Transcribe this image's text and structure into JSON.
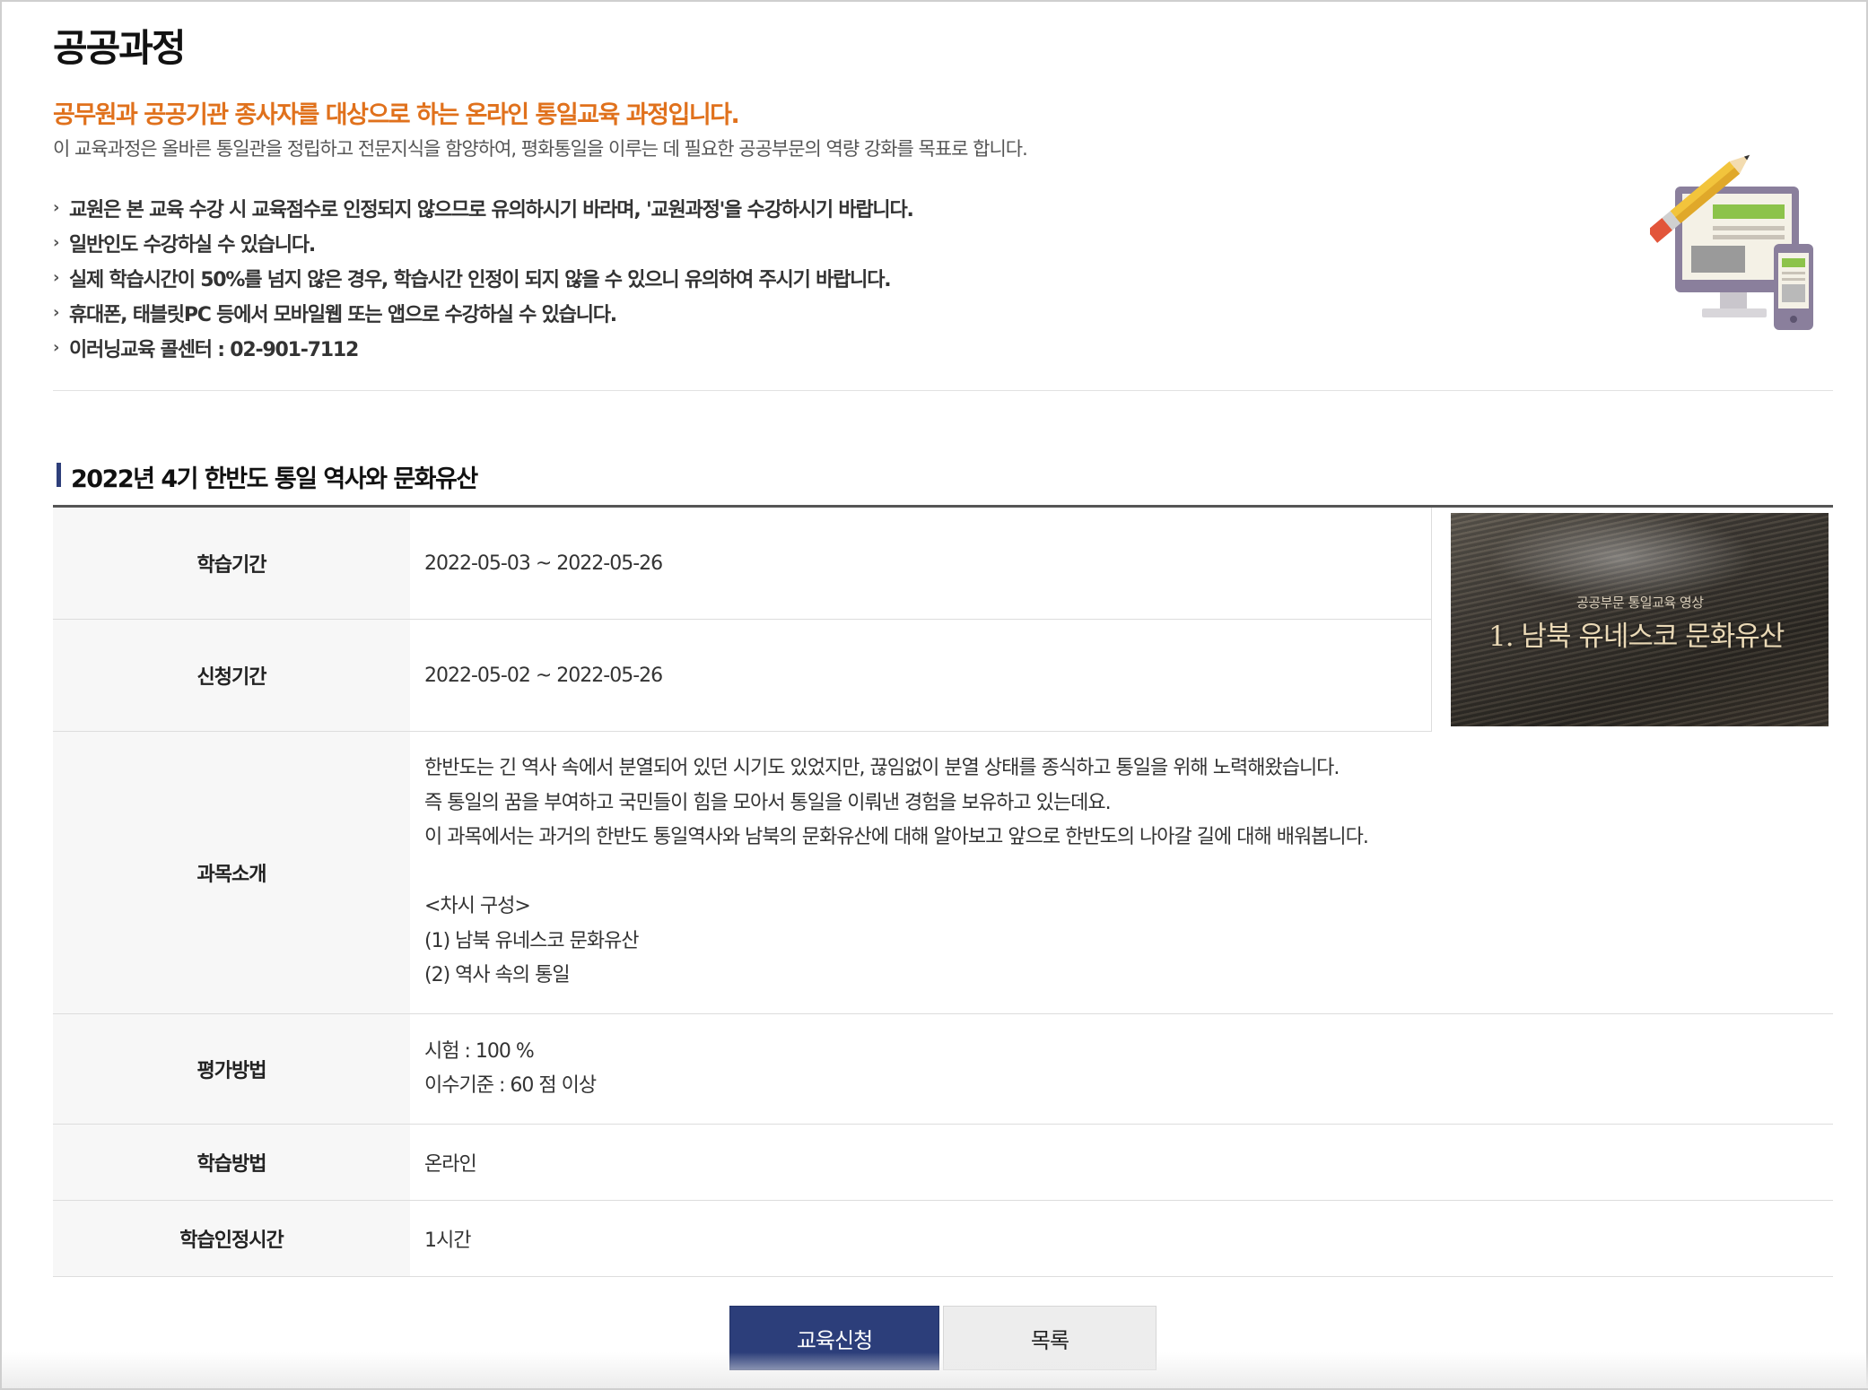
{
  "page": {
    "title": "공공과정"
  },
  "intro": {
    "headline": "공무원과 공공기관 종사자를 대상으로 하는 온라인 통일교육 과정입니다.",
    "description": "이 교육과정은 올바른 통일관을 정립하고 전문지식을 함양하여, 평화통일을 이루는 데 필요한 공공부문의 역량 강화를 목표로 합니다.",
    "notices": [
      "교원은 본 교육 수강 시 교육점수로 인정되지 않으므로 유의하시기 바라며, '교원과정'을 수강하시기 바랍니다.",
      "일반인도 수강하실 수 있습니다.",
      "실제 학습시간이 50%를 넘지 않은 경우, 학습시간 인정이 되지 않을 수 있으니 유의하여 주시기 바랍니다.",
      "휴대폰, 태블릿PC 등에서 모바일웹 또는 앱으로 수강하실 수 있습니다.",
      "이러닝교육 콜센터 : 02-901-7112"
    ],
    "notice_marker": "›",
    "illustration_icon": "pencil-monitor-mobile-icon"
  },
  "course": {
    "title": "2022년 4기 한반도 통일 역사와 문화유산",
    "thumbnail": {
      "subtitle": "공공부문 통일교육 영상",
      "caption": "1. 남북 유네스코 문화유산"
    },
    "rows": {
      "study_period": {
        "label": "학습기간",
        "value": "2022-05-03 ~ 2022-05-26"
      },
      "apply_period": {
        "label": "신청기간",
        "value": "2022-05-02 ~ 2022-05-26"
      },
      "intro": {
        "label": "과목소개",
        "lines": [
          "한반도는 긴 역사 속에서 분열되어 있던 시기도 있었지만, 끊임없이 분열 상태를 종식하고 통일을 위해 노력해왔습니다.",
          "즉 통일의 꿈을 부여하고 국민들이 힘을 모아서 통일을 이뤄낸 경험을 보유하고 있는데요.",
          "이 과목에서는 과거의 한반도 통일역사와 남북의 문화유산에 대해 알아보고 앞으로 한반도의 나아갈 길에 대해 배워봅니다.",
          "",
          "<차시 구성>",
          "(1) 남북 유네스코 문화유산",
          "(2) 역사 속의 통일"
        ]
      },
      "evaluation": {
        "label": "평가방법",
        "lines": [
          "시험 : 100 %",
          "이수기준 : 60 점 이상"
        ]
      },
      "method": {
        "label": "학습방법",
        "value": "온라인"
      },
      "credit_hours": {
        "label": "학습인정시간",
        "value": "1시간"
      }
    }
  },
  "buttons": {
    "apply": "교육신청",
    "list": "목록"
  },
  "colors": {
    "accent_orange": "#e0711c",
    "primary_navy": "#2c3e7a",
    "section_bar": "#2e3f7a"
  }
}
